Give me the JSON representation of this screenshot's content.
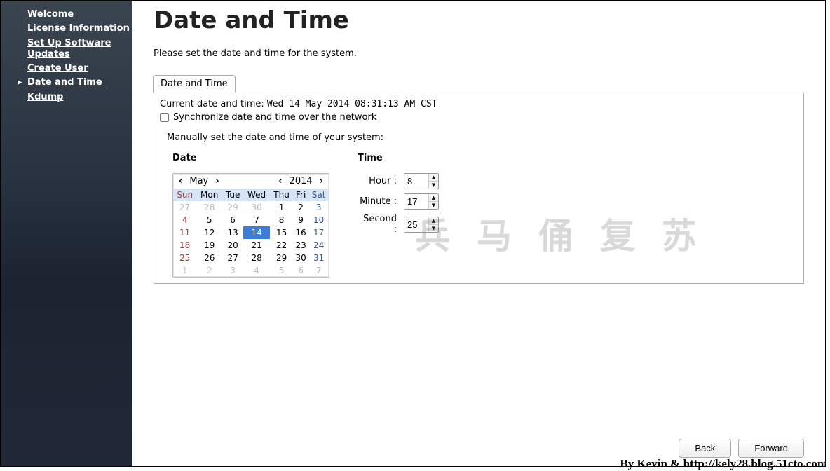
{
  "sidebar": {
    "items": [
      {
        "label": "Welcome"
      },
      {
        "label": "License Information"
      },
      {
        "label": "Set Up Software Updates"
      },
      {
        "label": "Create User"
      },
      {
        "label": "Date and Time"
      },
      {
        "label": "Kdump"
      }
    ],
    "active_index": 4
  },
  "page": {
    "title": "Date and Time",
    "description": "Please set the date and time for the system."
  },
  "tab": {
    "label": "Date and Time"
  },
  "current": {
    "label": "Current date and time:  ",
    "value": "Wed 14 May 2014 08:31:13 AM CST"
  },
  "sync": {
    "checked": false,
    "label": "Synchronize date and time over the network"
  },
  "manual": {
    "description": "Manually set the date and time of your system:"
  },
  "date_section": {
    "header": "Date",
    "month": "May",
    "year": "2014",
    "day_headers": [
      "Sun",
      "Mon",
      "Tue",
      "Wed",
      "Thu",
      "Fri",
      "Sat"
    ],
    "weeks": [
      [
        {
          "d": "27",
          "o": true
        },
        {
          "d": "28",
          "o": true
        },
        {
          "d": "29",
          "o": true
        },
        {
          "d": "30",
          "o": true
        },
        {
          "d": "1"
        },
        {
          "d": "2"
        },
        {
          "d": "3"
        }
      ],
      [
        {
          "d": "4"
        },
        {
          "d": "5"
        },
        {
          "d": "6"
        },
        {
          "d": "7"
        },
        {
          "d": "8"
        },
        {
          "d": "9"
        },
        {
          "d": "10"
        }
      ],
      [
        {
          "d": "11"
        },
        {
          "d": "12"
        },
        {
          "d": "13"
        },
        {
          "d": "14",
          "sel": true
        },
        {
          "d": "15"
        },
        {
          "d": "16"
        },
        {
          "d": "17"
        }
      ],
      [
        {
          "d": "18"
        },
        {
          "d": "19"
        },
        {
          "d": "20"
        },
        {
          "d": "21"
        },
        {
          "d": "22"
        },
        {
          "d": "23"
        },
        {
          "d": "24"
        }
      ],
      [
        {
          "d": "25"
        },
        {
          "d": "26"
        },
        {
          "d": "27"
        },
        {
          "d": "28"
        },
        {
          "d": "29"
        },
        {
          "d": "30"
        },
        {
          "d": "31"
        }
      ],
      [
        {
          "d": "1",
          "o": true
        },
        {
          "d": "2",
          "o": true
        },
        {
          "d": "3",
          "o": true
        },
        {
          "d": "4",
          "o": true
        },
        {
          "d": "5",
          "o": true
        },
        {
          "d": "6",
          "o": true
        },
        {
          "d": "7",
          "o": true
        }
      ]
    ]
  },
  "time_section": {
    "header": "Time",
    "hour_label": "Hour :",
    "hour_value": "8",
    "minute_label": "Minute :",
    "minute_value": "17",
    "second_label": "Second :",
    "second_value": "25"
  },
  "buttons": {
    "back": "Back",
    "forward": "Forward"
  },
  "watermark": {
    "cjk": "兵马俑复苏",
    "credit": "By Kevin & http://kely28.blog.51cto.com"
  }
}
